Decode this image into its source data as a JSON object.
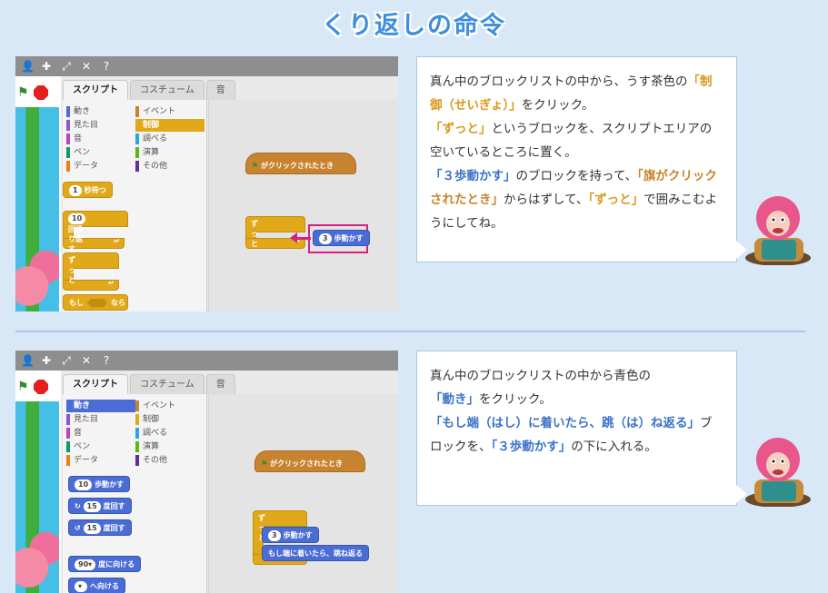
{
  "title": "くり返しの命令",
  "editor": {
    "tabs": [
      "スクリプト",
      "コスチューム",
      "音"
    ],
    "categories": [
      {
        "label": "動き",
        "color": "#4a6cd4"
      },
      {
        "label": "イベント",
        "color": "#c88330"
      },
      {
        "label": "見た目",
        "color": "#8a55d7"
      },
      {
        "label": "制御",
        "color": "#e1a91a"
      },
      {
        "label": "音",
        "color": "#bb42c3"
      },
      {
        "label": "調べる",
        "color": "#2ca5e2"
      },
      {
        "label": "ペン",
        "color": "#0e9a6c"
      },
      {
        "label": "演算",
        "color": "#5cb712"
      },
      {
        "label": "データ",
        "color": "#ee7d16"
      },
      {
        "label": "その他",
        "color": "#632d99"
      }
    ]
  },
  "step1": {
    "selected_category": "制御",
    "palette_blocks": {
      "wait_num": "1",
      "wait_label": "秒待つ",
      "repeat_num": "10",
      "repeat_label": "回繰り返す",
      "forever_label": "ずっと",
      "if_label": "もし",
      "if_then": "なら"
    },
    "script": {
      "hat_label": "がクリックされたとき",
      "forever_label": "ずっと",
      "move_num": "3",
      "move_label": "歩動かす"
    },
    "instruction": {
      "l1a": "真ん中のブロックリストの中から、うす茶色の",
      "l1b": "「制御（せいぎょ）」",
      "l1c": "をクリック。",
      "l2a": "「ずっと」",
      "l2b": "というブロックを、スクリプトエリアの空いているところに置く。",
      "l3a": "「３歩動かす」",
      "l3b": "のブロックを持って、",
      "l3c": "「旗がクリックされたとき」",
      "l3d": "からはずして、",
      "l3e": "「ずっと」",
      "l3f": "で囲みこむようにしてね。"
    }
  },
  "step2": {
    "selected_category": "動き",
    "palette_blocks": {
      "move_num": "10",
      "move_label": "歩動かす",
      "turn_r_num": "15",
      "turn_r_label": "度回す",
      "turn_l_num": "15",
      "turn_l_label": "度回す",
      "point_num": "90▾",
      "point_label": "度に向ける",
      "toward_label": "へ向ける"
    },
    "script": {
      "hat_label": "がクリックされたとき",
      "forever_label": "ずっと",
      "move_num": "3",
      "move_label": "歩動かす",
      "bounce_label": "もし端に着いたら、跳ね返る"
    },
    "instruction": {
      "l1a": "真ん中のブロックリストの中から青色の",
      "l1b": "「動き」",
      "l1c": "をクリック。",
      "l2a": "「もし端（はし）に着いたら、跳（は）ね返る」",
      "l2b": "ブロックを、",
      "l2c": "「３歩動かす」",
      "l2d": "の下に入れる。"
    }
  }
}
